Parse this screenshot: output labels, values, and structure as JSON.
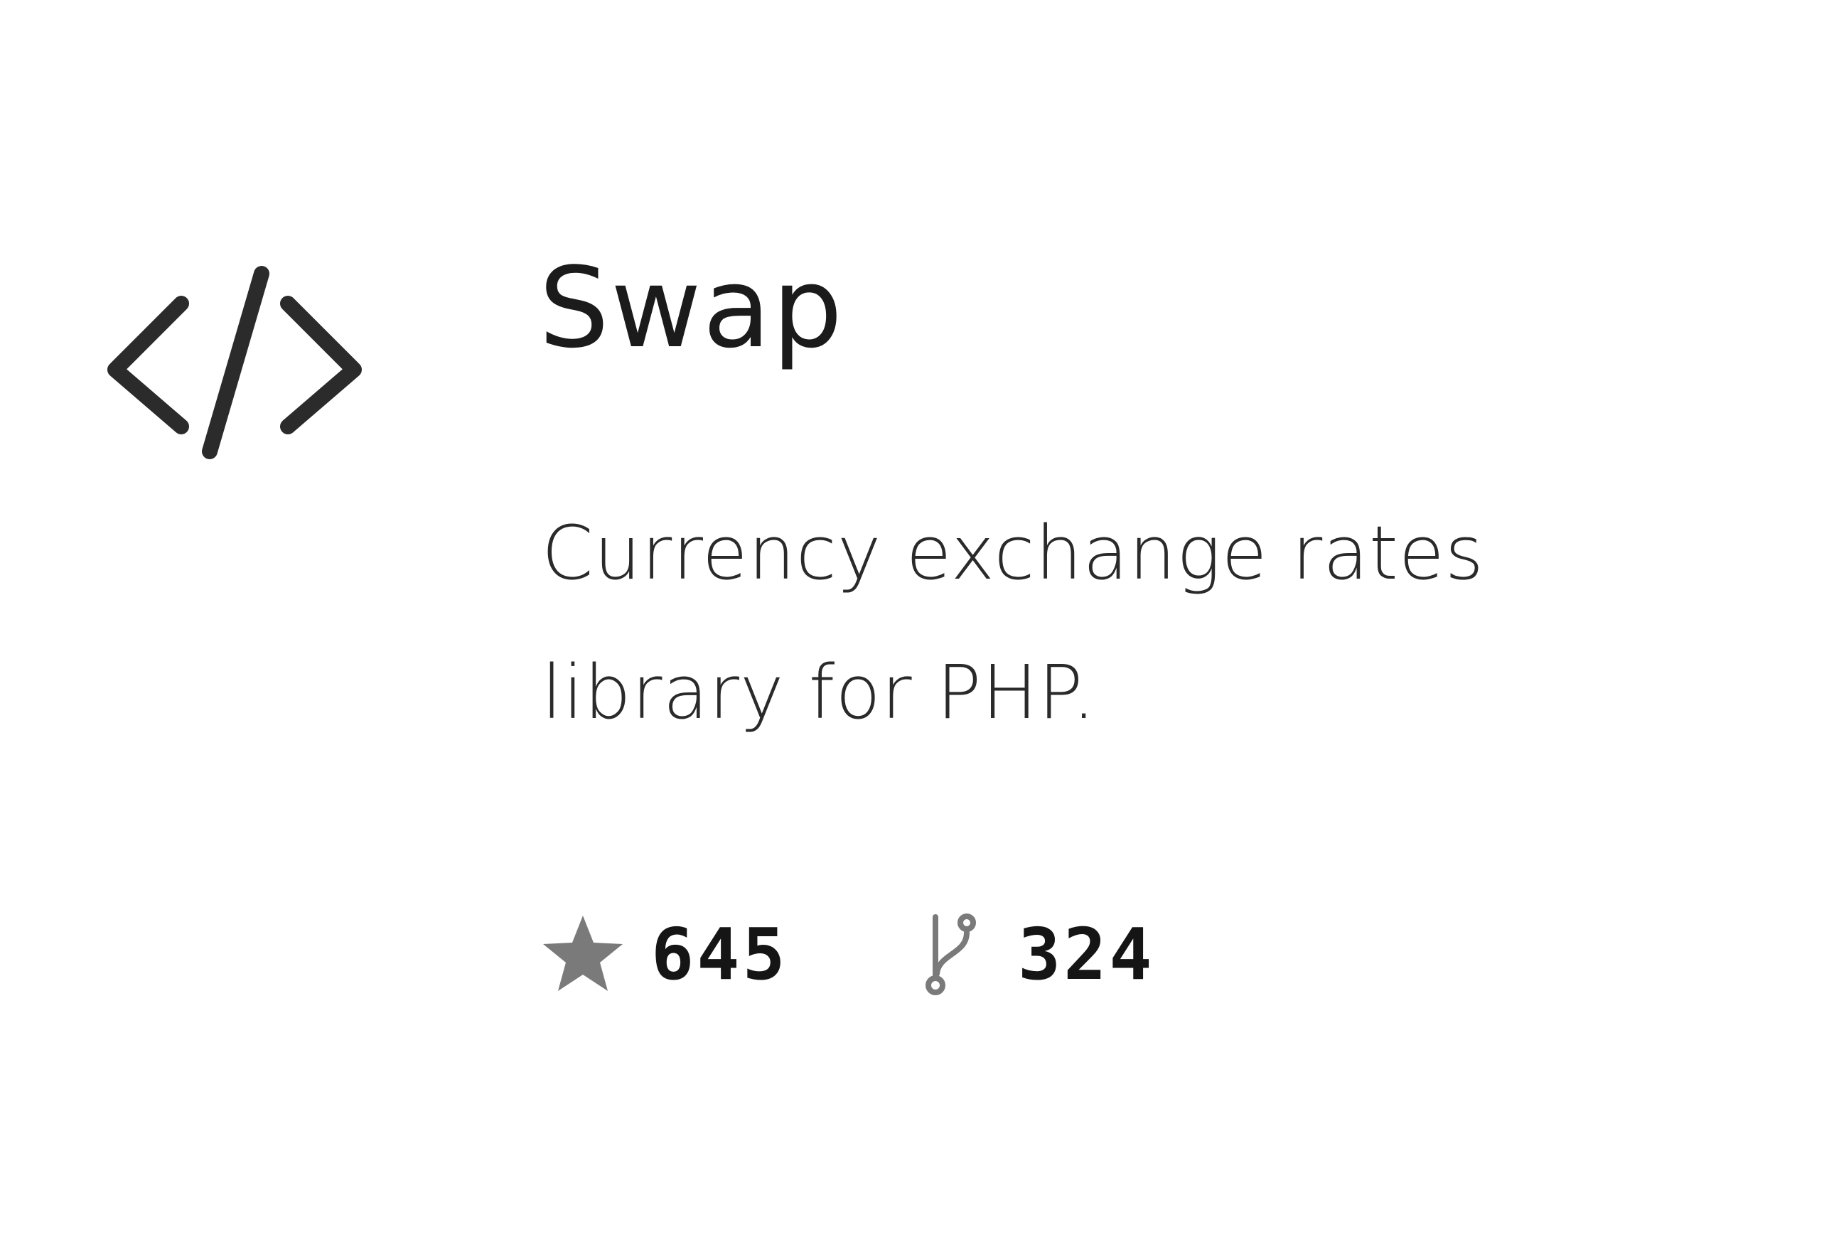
{
  "repo": {
    "icon": "code-brackets-icon",
    "title": "Swap",
    "description": "Currency exchange rates library for PHP.",
    "stats": {
      "stars": {
        "icon": "star-icon",
        "count": "645"
      },
      "forks": {
        "icon": "fork-icon",
        "count": "324"
      }
    }
  },
  "colors": {
    "text": "#1b1b1b",
    "icon": "#2b2b2b",
    "stat_icon": "#7a7a7a",
    "background": "#ffffff"
  }
}
